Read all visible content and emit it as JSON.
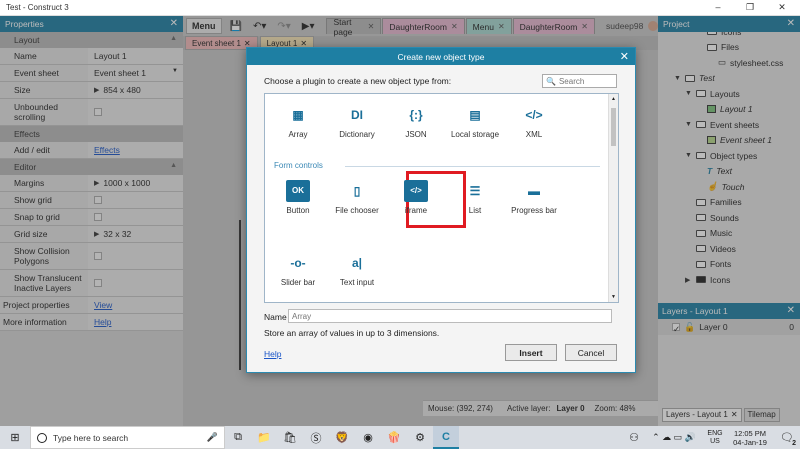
{
  "window": {
    "title": "Test - Construct 3",
    "controls": [
      "–",
      "❐",
      "✕"
    ]
  },
  "properties": {
    "title": "Properties",
    "layout_group": "Layout",
    "rows_layout": [
      {
        "k": "Name",
        "v": "Layout 1"
      },
      {
        "k": "Event sheet",
        "v": "Event sheet 1"
      },
      {
        "k": "Size",
        "v": "854 x 480"
      },
      {
        "k": "Unbounded scrolling",
        "v": ""
      }
    ],
    "effects_group": "Effects",
    "add_edit": "Add / edit",
    "effects_link": "Effects",
    "editor_group": "Editor",
    "rows_editor": [
      {
        "k": "Margins",
        "v": "1000 x 1000"
      },
      {
        "k": "Show grid",
        "v": ""
      },
      {
        "k": "Snap to grid",
        "v": ""
      },
      {
        "k": "Grid size",
        "v": "32 x 32"
      },
      {
        "k": "Show Collision Polygons",
        "v": ""
      },
      {
        "k": "Show Translucent Inactive Layers",
        "v": ""
      }
    ],
    "project_properties": "Project properties",
    "view_link": "View",
    "more_information": "More information",
    "help_link": "Help"
  },
  "toolbar": {
    "menu": "Menu"
  },
  "tabs": [
    {
      "label": "Start page",
      "color": "#b8b8b8"
    },
    {
      "label": "DaughterRoom",
      "color": "#e7b7d0"
    },
    {
      "label": "Menu",
      "color": "#a8d8d0"
    },
    {
      "label": "DaughterRoom",
      "color": "#e7b7d0"
    }
  ],
  "user": "sudeep98",
  "subtabs": [
    {
      "label": "Event sheet 1",
      "color": "#f2b9b9"
    },
    {
      "label": "Layout 1",
      "color": "#f6e3b6"
    }
  ],
  "status": {
    "mouse": "Mouse: (392, 274)",
    "active_layer_label": "Active layer:",
    "active_layer": "Layer 0",
    "zoom": "Zoom: 48%"
  },
  "project": {
    "title": "Project",
    "tree": [
      {
        "label": "Icons",
        "icon": "folder",
        "depth": 2,
        "car": ""
      },
      {
        "label": "Files",
        "icon": "folder",
        "depth": 2,
        "car": ""
      },
      {
        "label": "stylesheet.css",
        "icon": "file",
        "depth": 3,
        "car": ""
      },
      {
        "label": "Test",
        "icon": "folder",
        "depth": 0,
        "car": "▼",
        "italic": true
      },
      {
        "label": "Layouts",
        "icon": "folder",
        "depth": 1,
        "car": "▼"
      },
      {
        "label": "Layout 1",
        "icon": "layout",
        "depth": 2,
        "car": "",
        "italic": true
      },
      {
        "label": "Event sheets",
        "icon": "folder",
        "depth": 1,
        "car": "▼"
      },
      {
        "label": "Event sheet 1",
        "icon": "eventsheet",
        "depth": 2,
        "car": "",
        "italic": true
      },
      {
        "label": "Object types",
        "icon": "folder",
        "depth": 1,
        "car": "▼"
      },
      {
        "label": "Text",
        "icon": "text",
        "depth": 2,
        "car": "",
        "italic": true
      },
      {
        "label": "Touch",
        "icon": "touch",
        "depth": 2,
        "car": "",
        "italic": true
      },
      {
        "label": "Families",
        "icon": "folder",
        "depth": 1,
        "car": ""
      },
      {
        "label": "Sounds",
        "icon": "folder",
        "depth": 1,
        "car": ""
      },
      {
        "label": "Music",
        "icon": "folder",
        "depth": 1,
        "car": ""
      },
      {
        "label": "Videos",
        "icon": "folder",
        "depth": 1,
        "car": ""
      },
      {
        "label": "Fonts",
        "icon": "folder",
        "depth": 1,
        "car": ""
      },
      {
        "label": "Icons",
        "icon": "folderfill",
        "depth": 1,
        "car": "▶"
      },
      {
        "label": "Files",
        "icon": "folder",
        "depth": 1,
        "car": ""
      }
    ]
  },
  "layers": {
    "title": "Layers - Layout 1",
    "layer_name": "Layer 0",
    "layer_index": "0"
  },
  "bottom_tabs": {
    "layers": "Layers - Layout 1",
    "tilemap": "Tilemap"
  },
  "dialog": {
    "title": "Create new object type",
    "prompt": "Choose a plugin to create a new object type from:",
    "search_placeholder": "Search",
    "section_form": "Form controls",
    "plugins_top": [
      {
        "label": "Array",
        "icon": "grid-icon",
        "glyph": "▦"
      },
      {
        "label": "Dictionary",
        "icon": "dictionary-icon",
        "glyph": "DI"
      },
      {
        "label": "JSON",
        "icon": "json-icon",
        "glyph": "{:}"
      },
      {
        "label": "Local storage",
        "icon": "local-storage-icon",
        "glyph": "▤"
      },
      {
        "label": "XML",
        "icon": "xml-icon",
        "glyph": "</>"
      }
    ],
    "plugins_form1": [
      {
        "label": "Button",
        "icon": "button-icon",
        "glyph": "OK"
      },
      {
        "label": "File chooser",
        "icon": "file-chooser-icon",
        "glyph": "▯"
      },
      {
        "label": "iframe",
        "icon": "iframe-icon",
        "glyph": "</>"
      },
      {
        "label": "List",
        "icon": "list-icon",
        "glyph": "☰"
      },
      {
        "label": "Progress bar",
        "icon": "progress-bar-icon",
        "glyph": "▬"
      }
    ],
    "plugins_form2": [
      {
        "label": "Slider bar",
        "icon": "slider-icon",
        "glyph": "-o-"
      },
      {
        "label": "Text input",
        "icon": "text-input-icon",
        "glyph": "a|"
      }
    ],
    "name_label": "Name",
    "name_placeholder": "Array",
    "description": "Store an array of values in up to 3 dimensions.",
    "help": "Help",
    "insert": "Insert",
    "cancel": "Cancel"
  },
  "taskbar": {
    "search_placeholder": "Type here to search",
    "lang": "ENG",
    "region": "US",
    "time": "12:05 PM",
    "date": "04-Jan-19",
    "notif_count": "2"
  }
}
